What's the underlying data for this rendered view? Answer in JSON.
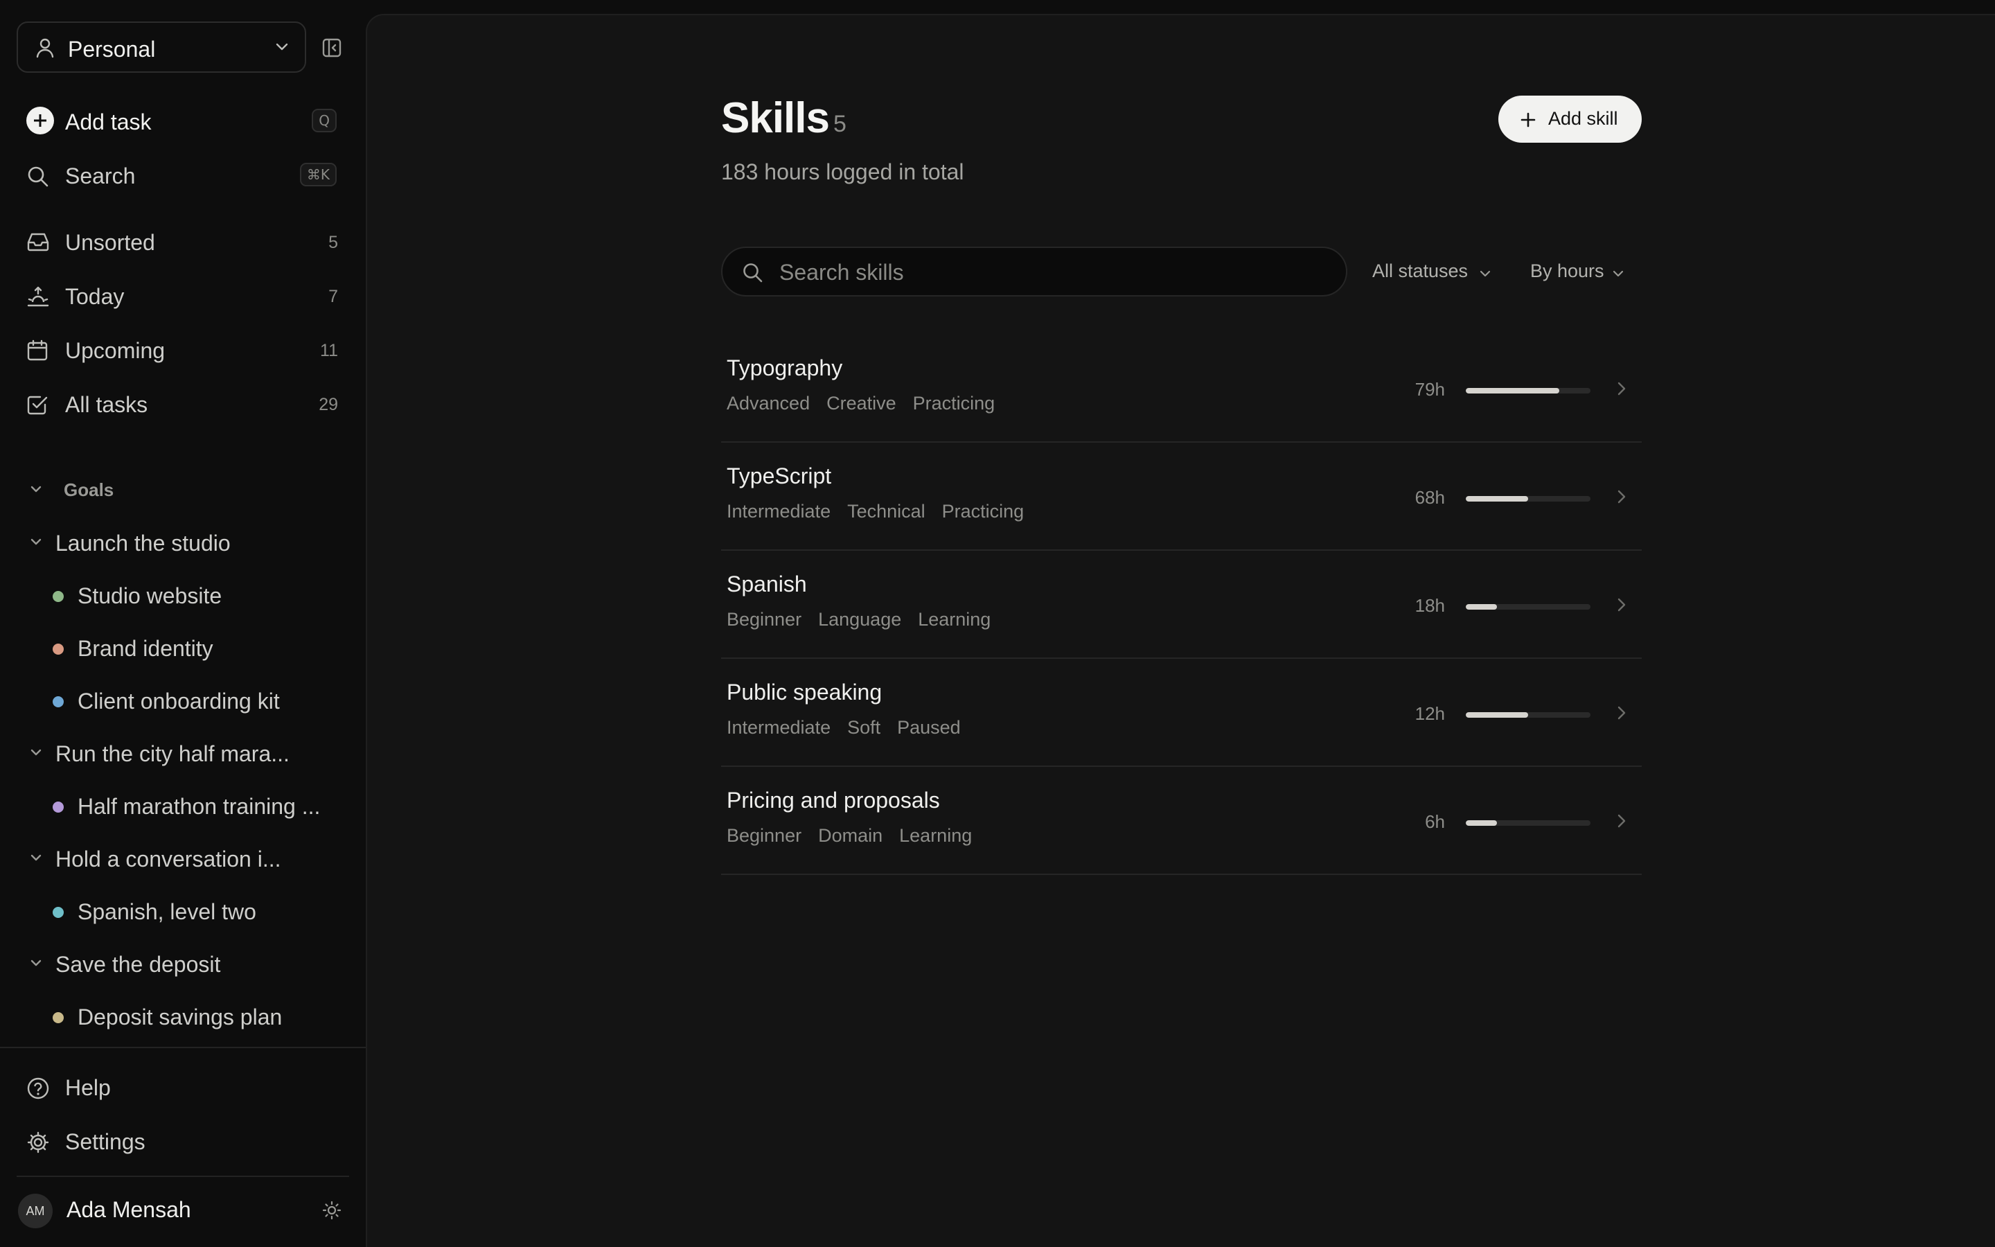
{
  "sidebar": {
    "workspace": {
      "label": "Personal"
    },
    "actions": {
      "add_task": {
        "label": "Add task",
        "shortcut": "Q"
      },
      "search": {
        "label": "Search",
        "shortcut": "⌘K"
      }
    },
    "nav": [
      {
        "label": "Unsorted",
        "count": "5",
        "icon": "inbox-icon"
      },
      {
        "label": "Today",
        "count": "7",
        "icon": "sunrise-icon"
      },
      {
        "label": "Upcoming",
        "count": "11",
        "icon": "calendar-icon"
      },
      {
        "label": "All tasks",
        "count": "29",
        "icon": "check-square-icon"
      }
    ],
    "goals_heading": "Goals",
    "goals": [
      {
        "label": "Launch the studio",
        "projects": [
          {
            "label": "Studio website",
            "color": "#8fb889"
          },
          {
            "label": "Brand identity",
            "color": "#d99a82"
          },
          {
            "label": "Client onboarding kit",
            "color": "#6fa8d6"
          }
        ]
      },
      {
        "label": "Run the city half mara...",
        "projects": [
          {
            "label": "Half marathon training ...",
            "color": "#b49ad9"
          }
        ]
      },
      {
        "label": "Hold a conversation i...",
        "projects": [
          {
            "label": "Spanish, level two",
            "color": "#6fbfc9"
          }
        ]
      },
      {
        "label": "Save the deposit",
        "projects": [
          {
            "label": "Deposit savings plan",
            "color": "#c9b98a"
          }
        ]
      }
    ],
    "footer": {
      "help": "Help",
      "settings": "Settings",
      "user": {
        "initials": "AM",
        "name": "Ada Mensah"
      }
    }
  },
  "main": {
    "title": "Skills",
    "count": "5",
    "subtitle": "183 hours logged in total",
    "add_button": "Add skill",
    "search_placeholder": "Search skills",
    "filters": {
      "status": "All statuses",
      "sort": "By hours"
    },
    "skills": [
      {
        "name": "Typography",
        "tags": [
          "Advanced",
          "Creative",
          "Practicing"
        ],
        "hours": "79h",
        "progress": 0.75
      },
      {
        "name": "TypeScript",
        "tags": [
          "Intermediate",
          "Technical",
          "Practicing"
        ],
        "hours": "68h",
        "progress": 0.5
      },
      {
        "name": "Spanish",
        "tags": [
          "Beginner",
          "Language",
          "Learning"
        ],
        "hours": "18h",
        "progress": 0.25
      },
      {
        "name": "Public speaking",
        "tags": [
          "Intermediate",
          "Soft",
          "Paused"
        ],
        "hours": "12h",
        "progress": 0.5
      },
      {
        "name": "Pricing and proposals",
        "tags": [
          "Beginner",
          "Domain",
          "Learning"
        ],
        "hours": "6h",
        "progress": 0.25
      }
    ]
  }
}
